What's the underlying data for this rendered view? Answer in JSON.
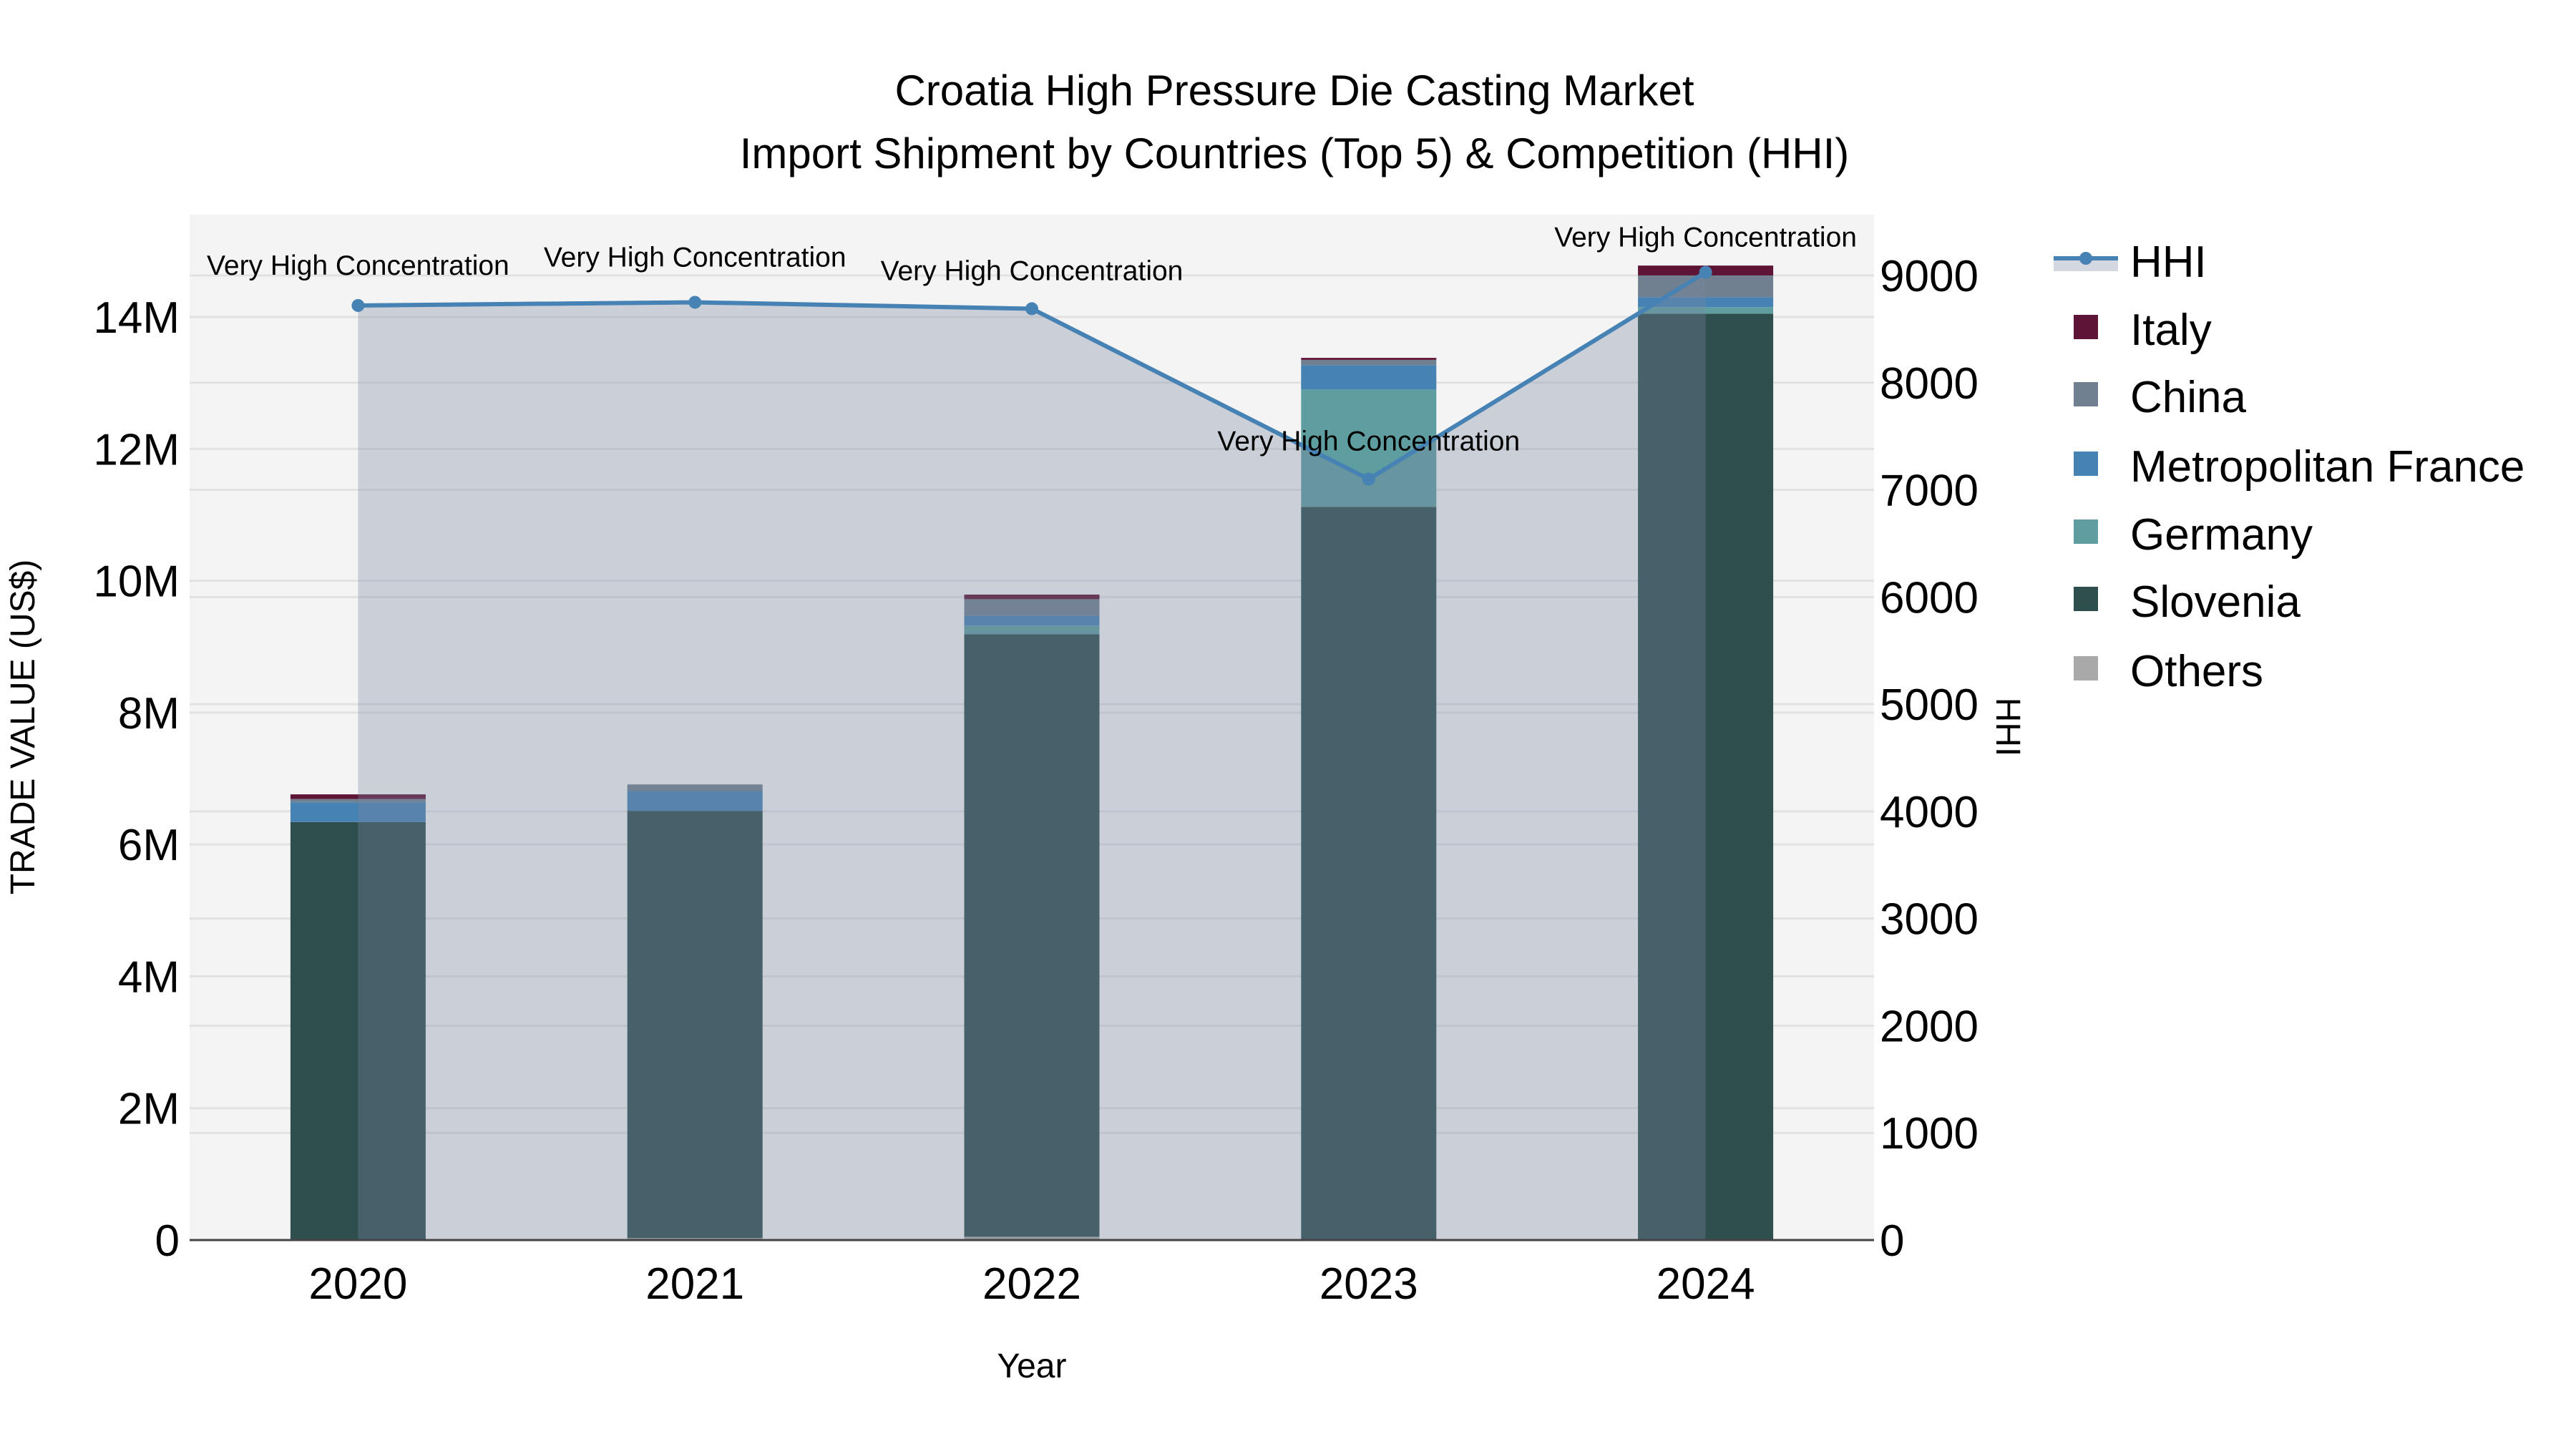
{
  "chart_data": {
    "type": "bar",
    "title": "Croatia High Pressure Die Casting Market",
    "subtitle": "Import Shipment by Countries (Top 5) & Competition (HHI)",
    "xlabel": "Year",
    "ylabel": "TRADE VALUE (US$)",
    "y2label": "HHI",
    "categories": [
      "2020",
      "2021",
      "2022",
      "2023",
      "2024"
    ],
    "ylim": [
      0,
      15500000
    ],
    "y2lim": [
      0,
      9550
    ],
    "yticks": [
      0,
      2000000,
      4000000,
      6000000,
      8000000,
      10000000,
      12000000,
      14000000
    ],
    "ytick_labels": [
      "0",
      "2M",
      "4M",
      "6M",
      "8M",
      "10M",
      "12M",
      "14M"
    ],
    "y2ticks": [
      0,
      1000,
      2000,
      3000,
      4000,
      5000,
      6000,
      7000,
      8000,
      9000
    ],
    "y2tick_labels": [
      "0",
      "1000",
      "2000",
      "3000",
      "4000",
      "5000",
      "6000",
      "7000",
      "8000",
      "9000"
    ],
    "grid": true,
    "legend_position": "right",
    "stack_order": [
      "Others",
      "Slovenia",
      "Germany",
      "Metropolitan France",
      "China",
      "Italy"
    ],
    "series": [
      {
        "name": "Others",
        "color": "#A9A9A9",
        "values": [
          10000,
          30000,
          50000,
          10000,
          10000
        ]
      },
      {
        "name": "Slovenia",
        "color": "#2F4F4F",
        "values": [
          6330000,
          6480000,
          9140000,
          11110000,
          14040000
        ]
      },
      {
        "name": "Germany",
        "color": "#5F9EA0",
        "values": [
          0,
          0,
          130000,
          1780000,
          100000
        ]
      },
      {
        "name": "Metropolitan France",
        "color": "#4682B4",
        "values": [
          300000,
          300000,
          150000,
          370000,
          150000
        ]
      },
      {
        "name": "China",
        "color": "#708090",
        "values": [
          50000,
          100000,
          250000,
          80000,
          330000
        ]
      },
      {
        "name": "Italy",
        "color": "#5E1435",
        "values": [
          70000,
          0,
          70000,
          30000,
          150000
        ]
      }
    ],
    "hhi": {
      "name": "HHI",
      "color": "#4682B4",
      "values": [
        8720,
        8750,
        8690,
        7100,
        9030
      ],
      "annotations": [
        "Very High Concentration",
        "Very High Concentration",
        "Very High Concentration",
        "Very High Concentration",
        "Very High Concentration"
      ]
    },
    "legend": [
      "HHI",
      "Italy",
      "China",
      "Metropolitan France",
      "Germany",
      "Slovenia",
      "Others"
    ]
  }
}
